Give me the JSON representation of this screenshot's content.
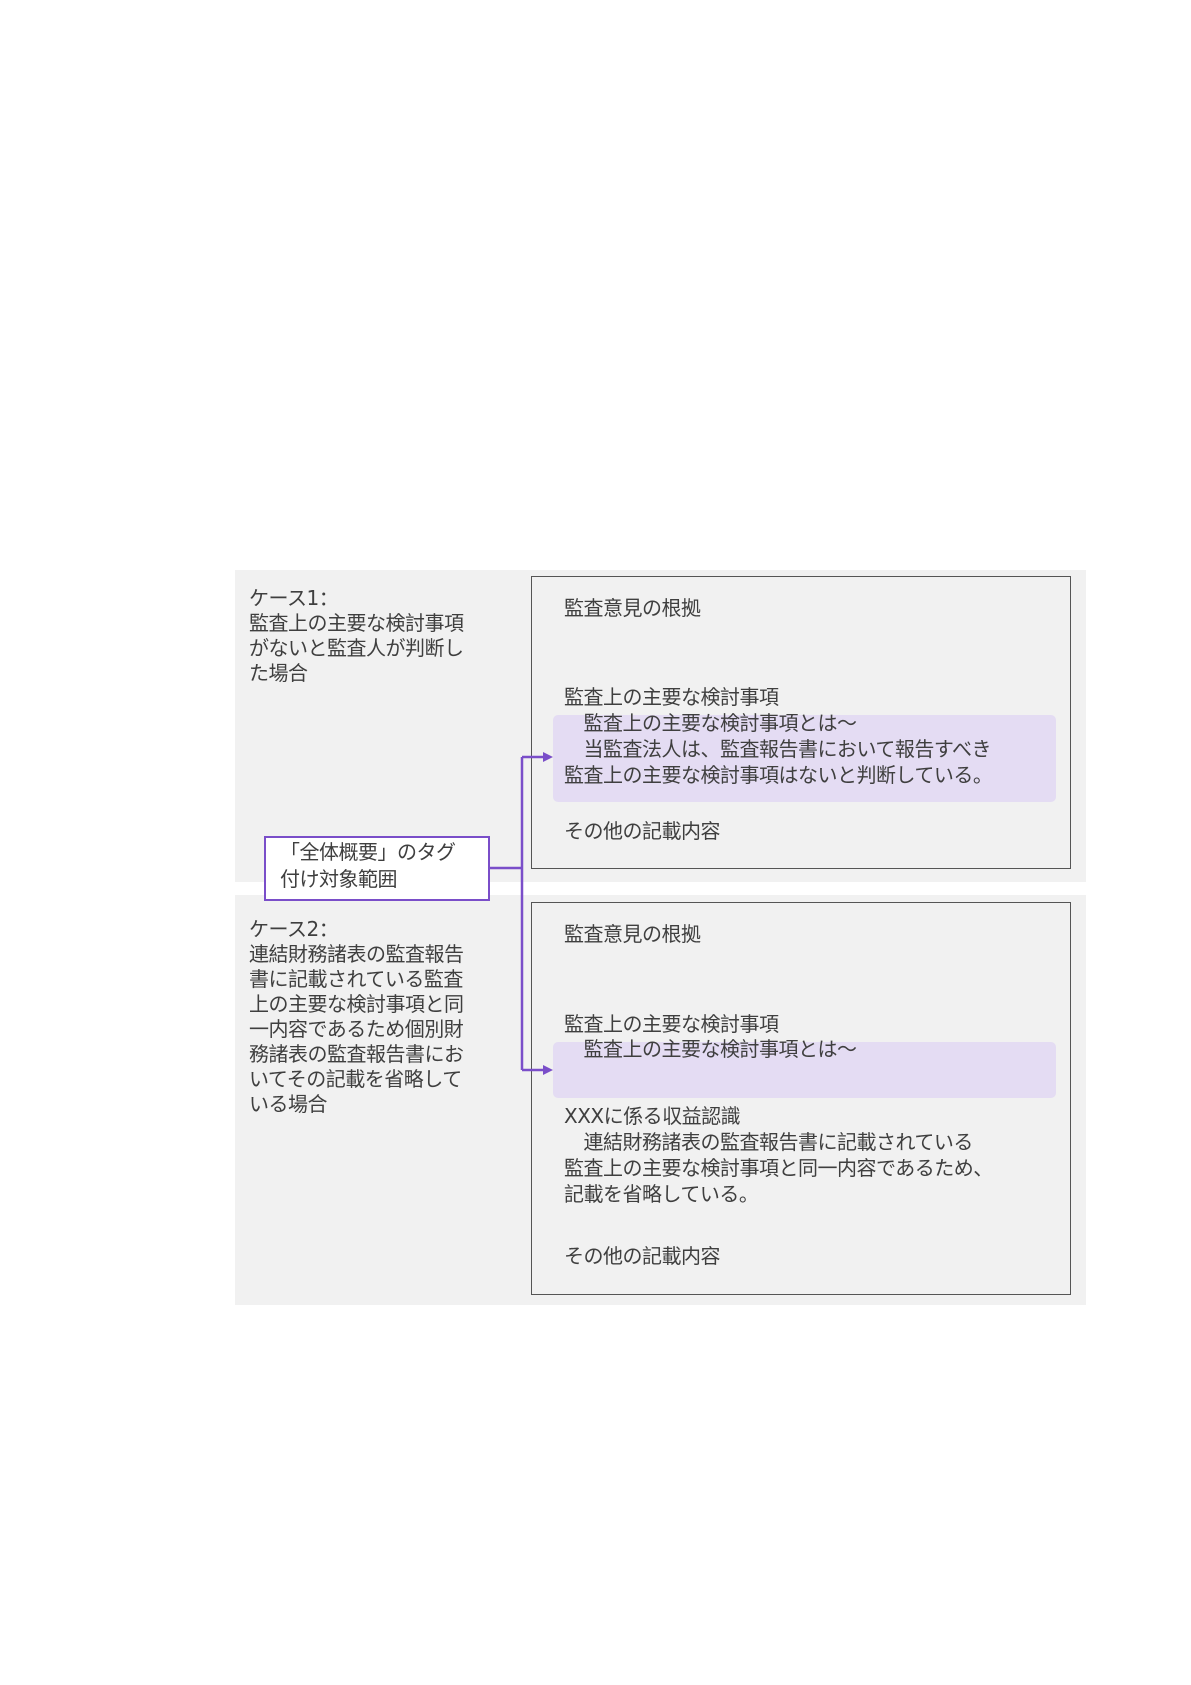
{
  "case1": {
    "label": "ケース1：",
    "description_lines": [
      "監査上の主要な検討事項",
      "がないと監査人が判断し",
      "た場合"
    ],
    "box": {
      "heading_basis": "監査意見の根拠",
      "heading_kam": "監査上の主要な検討事項",
      "kam_lines": [
        "　監査上の主要な検討事項とは～",
        "　当監査法人は、監査報告書において報告すべき",
        "監査上の主要な検討事項はないと判断している。"
      ],
      "heading_other": "その他の記載内容"
    }
  },
  "tag_label_lines": [
    "「全体概要」のタグ",
    "付け対象範囲"
  ],
  "case2": {
    "label": "ケース2：",
    "description_lines": [
      "連結財務諸表の監査報告",
      "書に記載されている監査",
      "上の主要な検討事項と同",
      "一内容であるため個別財",
      "務諸表の監査報告書にお",
      "いてその記載を省略して",
      "いる場合"
    ],
    "box": {
      "heading_basis": "監査意見の根拠",
      "heading_kam": "監査上の主要な検討事項",
      "kam_lines": [
        "　監査上の主要な検討事項とは～"
      ],
      "item_title": "XXXに係る収益認識",
      "item_lines": [
        "　連結財務諸表の監査報告書に記載されている",
        "監査上の主要な検討事項と同一内容であるため、",
        "記載を省略している。"
      ],
      "heading_other": "その他の記載内容"
    }
  },
  "colors": {
    "panel_bg": "#f1f1f1",
    "highlight": "#e4dcf3",
    "accent_purple": "#7a4ec9",
    "box_border": "#555555",
    "text": "#3f3f3f"
  }
}
